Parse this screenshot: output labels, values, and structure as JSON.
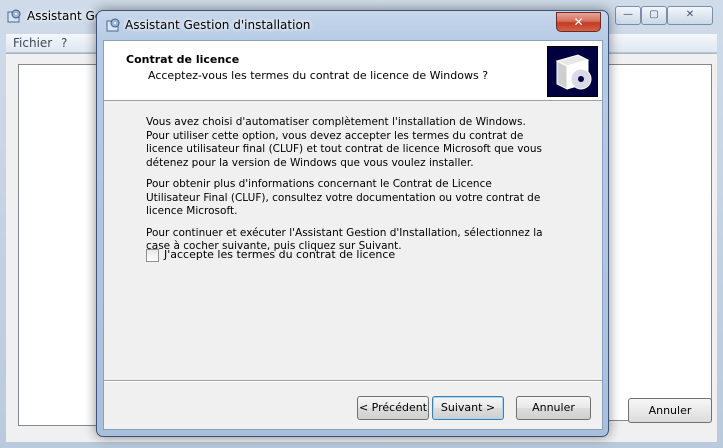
{
  "background_window": {
    "title": "Assistant Ges",
    "menu": [
      "Fichier",
      "?"
    ],
    "controls": {
      "minimize": "—",
      "maximize": "▢",
      "close": "✕"
    },
    "cancel_label": "Annuler"
  },
  "dialog": {
    "title": "Assistant Gestion d'installation",
    "close_glyph": "✕",
    "header": {
      "title": "Contrat de licence",
      "subtitle": "Acceptez-vous les termes du contrat de licence de Windows ?"
    },
    "paragraphs": [
      "Vous avez choisi d'automatiser complètement l'installation de Windows. Pour utiliser cette option, vous devez accepter les termes du contrat de licence utilisateur final (CLUF) et tout contrat de licence Microsoft que vous détenez pour la version de Windows que vous voulez installer.",
      "Pour obtenir plus d'informations concernant le Contrat de Licence Utilisateur Final (CLUF), consultez votre documentation ou votre contrat de licence Microsoft.",
      "Pour continuer et exécuter l'Assistant Gestion d'Installation, sélectionnez la case à cocher suivante, puis cliquez sur Suivant."
    ],
    "checkbox": {
      "label": "J'accepte les termes du contrat de licence",
      "checked": false
    },
    "buttons": {
      "back": "< Précédent",
      "next": "Suivant >",
      "cancel": "Annuler"
    }
  },
  "colors": {
    "header_bg": "#ffffff",
    "dialog_frame": "#b6cbe4",
    "close_red": "#c13b22"
  },
  "icons": [
    "setup-app-icon",
    "cd-box-icon"
  ]
}
